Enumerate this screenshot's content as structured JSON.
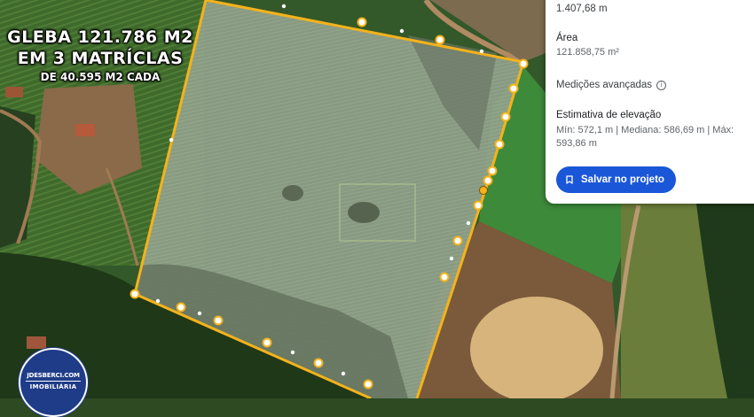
{
  "overlay": {
    "line1": "GLEBA 121.786 M2",
    "line2": "EM 3 MATRÍCLAS",
    "line3": "DE 40.595 M2 CADA"
  },
  "logo": {
    "line1": "JDESBERCI.COM",
    "line2": "IMOBILIÁRIA"
  },
  "panel": {
    "perimeter_value": "1.407,68 m",
    "area_label": "Área",
    "area_value": "121.858,75 m²",
    "advanced_label": "Medições avançadas",
    "elevation_label": "Estimativa de elevação",
    "elevation_value": "Mín: 572,1 m | Mediana: 586,69 m | Máx: 593,86 m",
    "save_button": "Salvar no projeto"
  },
  "colors": {
    "boundary": "#f5b21b",
    "button": "#1a57d8",
    "logo": "#1f3c88"
  },
  "icons": [
    "info-icon",
    "bookmark-icon"
  ]
}
